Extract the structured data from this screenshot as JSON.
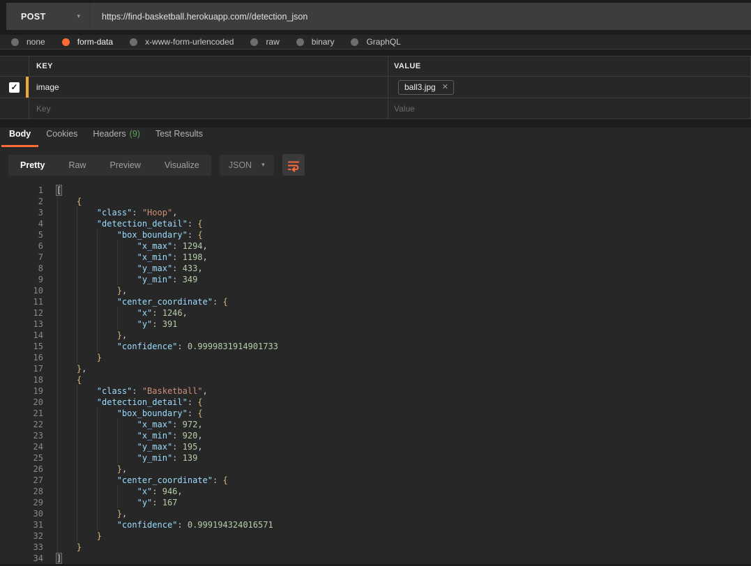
{
  "request": {
    "method": "POST",
    "url": "https://find-basketball.herokuapp.com//detection_json",
    "method_chevron_icon": "▾"
  },
  "body_types": [
    {
      "label": "none",
      "selected": false
    },
    {
      "label": "form-data",
      "selected": true
    },
    {
      "label": "x-www-form-urlencoded",
      "selected": false
    },
    {
      "label": "raw",
      "selected": false
    },
    {
      "label": "binary",
      "selected": false
    },
    {
      "label": "GraphQL",
      "selected": false
    }
  ],
  "params_table": {
    "key_header": "KEY",
    "value_header": "VALUE",
    "rows": [
      {
        "checked": true,
        "check_glyph": "✓",
        "key": "image",
        "file_value": "ball3.jpg",
        "remove_glyph": "✕"
      }
    ],
    "new_row": {
      "key_placeholder": "Key",
      "value_placeholder": "Value"
    }
  },
  "response_tabs": [
    {
      "label": "Body",
      "count": "",
      "active": true
    },
    {
      "label": "Cookies",
      "count": "",
      "active": false
    },
    {
      "label": "Headers",
      "count": "(9)",
      "active": false
    },
    {
      "label": "Test Results",
      "count": "",
      "active": false
    }
  ],
  "viewer": {
    "modes": [
      {
        "label": "Pretty",
        "active": true
      },
      {
        "label": "Raw",
        "active": false
      },
      {
        "label": "Preview",
        "active": false
      },
      {
        "label": "Visualize",
        "active": false
      }
    ],
    "format": "JSON",
    "format_chevron_icon": "▾"
  },
  "colors": {
    "accent_orange": "#ff6c37",
    "row_accent_amber": "#eda73c",
    "headers_count_green": "#58a55c",
    "code_key": "#9cdcfe",
    "code_string": "#ce9178",
    "code_number": "#b5cea8",
    "code_brace": "#d7ba7d"
  },
  "code": {
    "lines": [
      {
        "n": 1,
        "i": 0,
        "t": [
          [
            "m",
            "["
          ]
        ]
      },
      {
        "n": 2,
        "i": 4,
        "t": [
          [
            "b",
            "{"
          ]
        ]
      },
      {
        "n": 3,
        "i": 8,
        "t": [
          [
            "k",
            "\"class\""
          ],
          [
            "p",
            ": "
          ],
          [
            "s",
            "\"Hoop\""
          ],
          [
            "p",
            ","
          ]
        ]
      },
      {
        "n": 4,
        "i": 8,
        "t": [
          [
            "k",
            "\"detection_detail\""
          ],
          [
            "p",
            ": "
          ],
          [
            "b",
            "{"
          ]
        ]
      },
      {
        "n": 5,
        "i": 12,
        "t": [
          [
            "k",
            "\"box_boundary\""
          ],
          [
            "p",
            ": "
          ],
          [
            "b",
            "{"
          ]
        ]
      },
      {
        "n": 6,
        "i": 16,
        "t": [
          [
            "k",
            "\"x_max\""
          ],
          [
            "p",
            ": "
          ],
          [
            "n",
            "1294"
          ],
          [
            "p",
            ","
          ]
        ]
      },
      {
        "n": 7,
        "i": 16,
        "t": [
          [
            "k",
            "\"x_min\""
          ],
          [
            "p",
            ": "
          ],
          [
            "n",
            "1198"
          ],
          [
            "p",
            ","
          ]
        ]
      },
      {
        "n": 8,
        "i": 16,
        "t": [
          [
            "k",
            "\"y_max\""
          ],
          [
            "p",
            ": "
          ],
          [
            "n",
            "433"
          ],
          [
            "p",
            ","
          ]
        ]
      },
      {
        "n": 9,
        "i": 16,
        "t": [
          [
            "k",
            "\"y_min\""
          ],
          [
            "p",
            ": "
          ],
          [
            "n",
            "349"
          ]
        ]
      },
      {
        "n": 10,
        "i": 12,
        "t": [
          [
            "b",
            "}"
          ],
          [
            "p",
            ","
          ]
        ]
      },
      {
        "n": 11,
        "i": 12,
        "t": [
          [
            "k",
            "\"center_coordinate\""
          ],
          [
            "p",
            ": "
          ],
          [
            "b",
            "{"
          ]
        ]
      },
      {
        "n": 12,
        "i": 16,
        "t": [
          [
            "k",
            "\"x\""
          ],
          [
            "p",
            ": "
          ],
          [
            "n",
            "1246"
          ],
          [
            "p",
            ","
          ]
        ]
      },
      {
        "n": 13,
        "i": 16,
        "t": [
          [
            "k",
            "\"y\""
          ],
          [
            "p",
            ": "
          ],
          [
            "n",
            "391"
          ]
        ]
      },
      {
        "n": 14,
        "i": 12,
        "t": [
          [
            "b",
            "}"
          ],
          [
            "p",
            ","
          ]
        ]
      },
      {
        "n": 15,
        "i": 12,
        "t": [
          [
            "k",
            "\"confidence\""
          ],
          [
            "p",
            ": "
          ],
          [
            "n",
            "0.9999831914901733"
          ]
        ]
      },
      {
        "n": 16,
        "i": 8,
        "t": [
          [
            "b",
            "}"
          ]
        ]
      },
      {
        "n": 17,
        "i": 4,
        "t": [
          [
            "b",
            "}"
          ],
          [
            "p",
            ","
          ]
        ]
      },
      {
        "n": 18,
        "i": 4,
        "t": [
          [
            "b",
            "{"
          ]
        ]
      },
      {
        "n": 19,
        "i": 8,
        "t": [
          [
            "k",
            "\"class\""
          ],
          [
            "p",
            ": "
          ],
          [
            "s",
            "\"Basketball\""
          ],
          [
            "p",
            ","
          ]
        ]
      },
      {
        "n": 20,
        "i": 8,
        "t": [
          [
            "k",
            "\"detection_detail\""
          ],
          [
            "p",
            ": "
          ],
          [
            "b",
            "{"
          ]
        ]
      },
      {
        "n": 21,
        "i": 12,
        "t": [
          [
            "k",
            "\"box_boundary\""
          ],
          [
            "p",
            ": "
          ],
          [
            "b",
            "{"
          ]
        ]
      },
      {
        "n": 22,
        "i": 16,
        "t": [
          [
            "k",
            "\"x_max\""
          ],
          [
            "p",
            ": "
          ],
          [
            "n",
            "972"
          ],
          [
            "p",
            ","
          ]
        ]
      },
      {
        "n": 23,
        "i": 16,
        "t": [
          [
            "k",
            "\"x_min\""
          ],
          [
            "p",
            ": "
          ],
          [
            "n",
            "920"
          ],
          [
            "p",
            ","
          ]
        ]
      },
      {
        "n": 24,
        "i": 16,
        "t": [
          [
            "k",
            "\"y_max\""
          ],
          [
            "p",
            ": "
          ],
          [
            "n",
            "195"
          ],
          [
            "p",
            ","
          ]
        ]
      },
      {
        "n": 25,
        "i": 16,
        "t": [
          [
            "k",
            "\"y_min\""
          ],
          [
            "p",
            ": "
          ],
          [
            "n",
            "139"
          ]
        ]
      },
      {
        "n": 26,
        "i": 12,
        "t": [
          [
            "b",
            "}"
          ],
          [
            "p",
            ","
          ]
        ]
      },
      {
        "n": 27,
        "i": 12,
        "t": [
          [
            "k",
            "\"center_coordinate\""
          ],
          [
            "p",
            ": "
          ],
          [
            "b",
            "{"
          ]
        ]
      },
      {
        "n": 28,
        "i": 16,
        "t": [
          [
            "k",
            "\"x\""
          ],
          [
            "p",
            ": "
          ],
          [
            "n",
            "946"
          ],
          [
            "p",
            ","
          ]
        ]
      },
      {
        "n": 29,
        "i": 16,
        "t": [
          [
            "k",
            "\"y\""
          ],
          [
            "p",
            ": "
          ],
          [
            "n",
            "167"
          ]
        ]
      },
      {
        "n": 30,
        "i": 12,
        "t": [
          [
            "b",
            "}"
          ],
          [
            "p",
            ","
          ]
        ]
      },
      {
        "n": 31,
        "i": 12,
        "t": [
          [
            "k",
            "\"confidence\""
          ],
          [
            "p",
            ": "
          ],
          [
            "n",
            "0.999194324016571"
          ]
        ]
      },
      {
        "n": 32,
        "i": 8,
        "t": [
          [
            "b",
            "}"
          ]
        ]
      },
      {
        "n": 33,
        "i": 4,
        "t": [
          [
            "b",
            "}"
          ]
        ]
      },
      {
        "n": 34,
        "i": 0,
        "t": [
          [
            "m",
            "]"
          ]
        ]
      }
    ]
  }
}
